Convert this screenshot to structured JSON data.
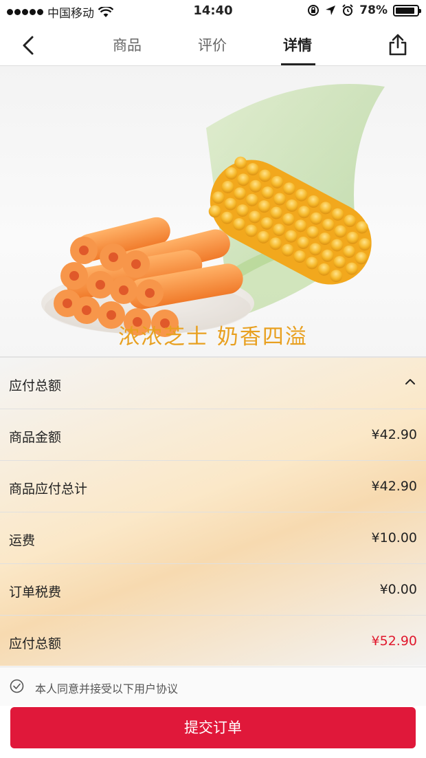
{
  "status_bar": {
    "carrier": "中国移动",
    "time": "14:40",
    "battery": "78%"
  },
  "nav": {
    "tabs": [
      {
        "label": "商品"
      },
      {
        "label": "评价"
      },
      {
        "label": "详情"
      }
    ],
    "active_tab": "详情"
  },
  "hero": {
    "caption": "浓浓芝士 奶香四溢"
  },
  "summary": {
    "header": "应付总额",
    "rows": [
      {
        "label": "商品金额",
        "value": "¥42.90"
      },
      {
        "label": "商品应付总计",
        "value": "¥42.90"
      },
      {
        "label": "运费",
        "value": "¥10.00"
      },
      {
        "label": "订单税费",
        "value": "¥0.00"
      },
      {
        "label": "应付总额",
        "value": "¥52.90"
      }
    ]
  },
  "agreement": {
    "text": "本人同意并接受以下用户协议"
  },
  "submit": {
    "label": "提交订单"
  },
  "colors": {
    "accent_red": "#e0183a",
    "total_red": "#e0182d",
    "caption_orange": "#e8a020"
  }
}
